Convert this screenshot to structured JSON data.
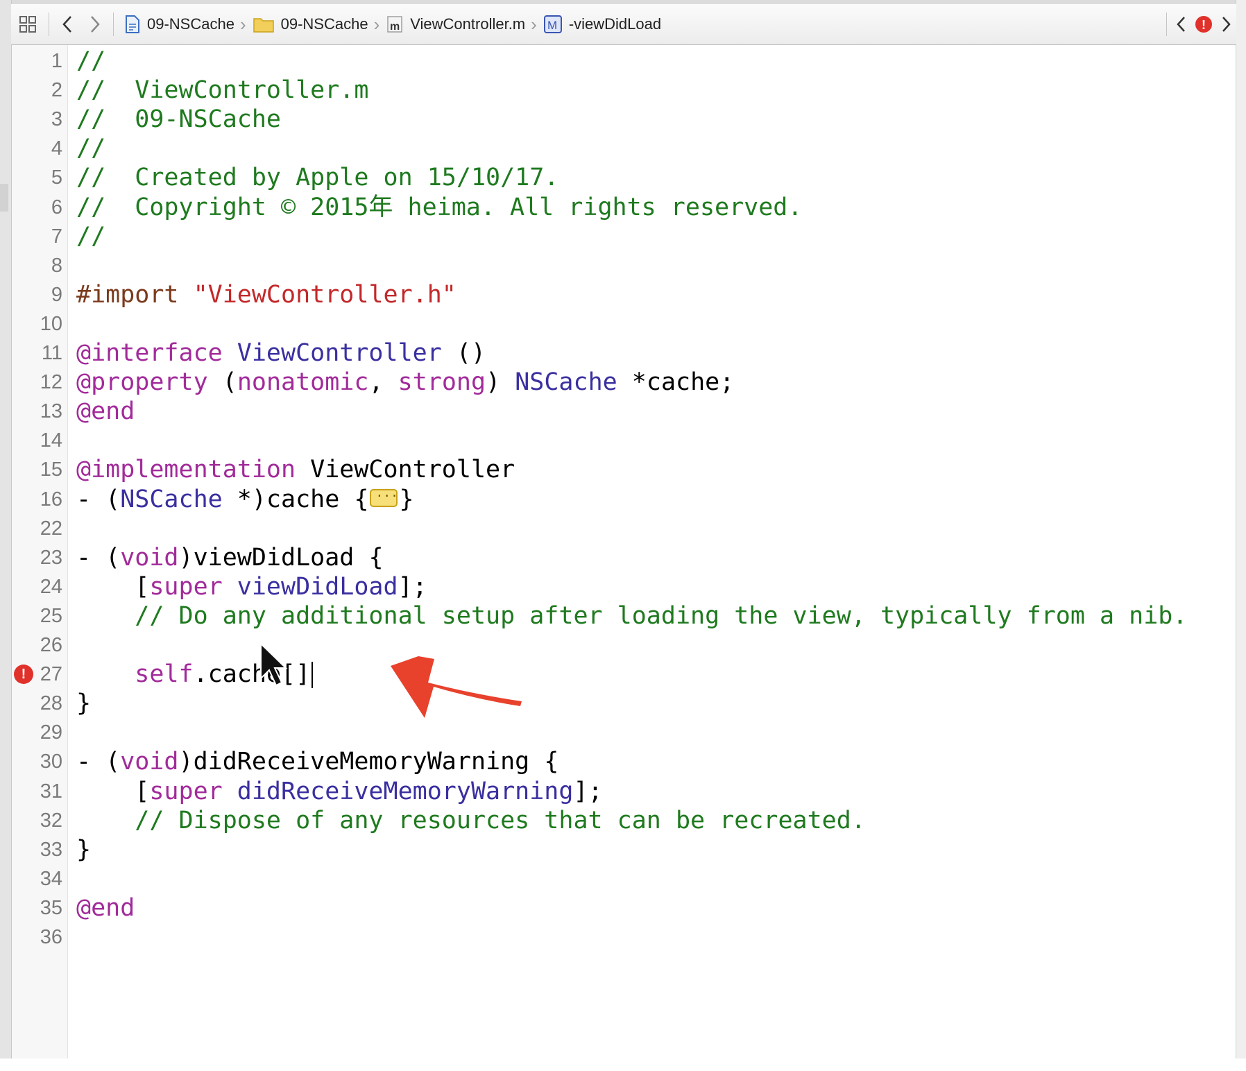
{
  "jumpbar": {
    "crumbs": [
      {
        "label": "09-NSCache",
        "icon": "project-file-icon"
      },
      {
        "label": "09-NSCache",
        "icon": "folder-icon"
      },
      {
        "label": "ViewController.m",
        "icon": "objc-m-file-icon"
      },
      {
        "label": "-viewDidLoad",
        "icon": "method-icon"
      }
    ],
    "method_icon_letter": "M",
    "m_file_letter": "m",
    "issue_badge": "!"
  },
  "editor": {
    "error_line": "27",
    "lines": [
      {
        "n": "1",
        "tokens": [
          {
            "t": "//",
            "c": "t-comment"
          }
        ]
      },
      {
        "n": "2",
        "tokens": [
          {
            "t": "//  ViewController.m",
            "c": "t-comment"
          }
        ]
      },
      {
        "n": "3",
        "tokens": [
          {
            "t": "//  09-NSCache",
            "c": "t-comment"
          }
        ]
      },
      {
        "n": "4",
        "tokens": [
          {
            "t": "//",
            "c": "t-comment"
          }
        ]
      },
      {
        "n": "5",
        "tokens": [
          {
            "t": "//  Created by Apple on 15/10/17.",
            "c": "t-comment"
          }
        ]
      },
      {
        "n": "6",
        "tokens": [
          {
            "t": "//  Copyright © 2015年 heima. All rights reserved.",
            "c": "t-comment"
          }
        ]
      },
      {
        "n": "7",
        "tokens": [
          {
            "t": "//",
            "c": "t-comment"
          }
        ]
      },
      {
        "n": "8",
        "tokens": []
      },
      {
        "n": "9",
        "tokens": [
          {
            "t": "#import ",
            "c": "t-pre"
          },
          {
            "t": "\"ViewController.h\"",
            "c": "t-string"
          }
        ]
      },
      {
        "n": "10",
        "tokens": []
      },
      {
        "n": "11",
        "tokens": [
          {
            "t": "@interface",
            "c": "t-key"
          },
          {
            "t": " ViewController ",
            "c": "t-class"
          },
          {
            "t": "()",
            "c": "t-plain"
          }
        ]
      },
      {
        "n": "12",
        "tokens": [
          {
            "t": "@property",
            "c": "t-key"
          },
          {
            "t": " (",
            "c": "t-plain"
          },
          {
            "t": "nonatomic",
            "c": "t-key"
          },
          {
            "t": ", ",
            "c": "t-plain"
          },
          {
            "t": "strong",
            "c": "t-key"
          },
          {
            "t": ") ",
            "c": "t-plain"
          },
          {
            "t": "NSCache",
            "c": "t-class"
          },
          {
            "t": " *cache;",
            "c": "t-plain"
          }
        ]
      },
      {
        "n": "13",
        "tokens": [
          {
            "t": "@end",
            "c": "t-key"
          }
        ]
      },
      {
        "n": "14",
        "tokens": []
      },
      {
        "n": "15",
        "tokens": [
          {
            "t": "@implementation",
            "c": "t-key"
          },
          {
            "t": " ViewController",
            "c": "t-plain"
          }
        ]
      },
      {
        "n": "16",
        "tokens": [
          {
            "t": "- (",
            "c": "t-plain"
          },
          {
            "t": "NSCache",
            "c": "t-class"
          },
          {
            "t": " *)cache {",
            "c": "t-plain"
          },
          {
            "fold": true
          },
          {
            "t": "}",
            "c": "t-plain"
          }
        ]
      },
      {
        "n": "22",
        "tokens": []
      },
      {
        "n": "23",
        "tokens": [
          {
            "t": "- (",
            "c": "t-plain"
          },
          {
            "t": "void",
            "c": "t-key"
          },
          {
            "t": ")viewDidLoad {",
            "c": "t-plain"
          }
        ]
      },
      {
        "n": "24",
        "tokens": [
          {
            "t": "    [",
            "c": "t-plain"
          },
          {
            "t": "super",
            "c": "t-key"
          },
          {
            "t": " viewDidLoad",
            "c": "t-method"
          },
          {
            "t": "];",
            "c": "t-plain"
          }
        ]
      },
      {
        "n": "25",
        "tokens": [
          {
            "t": "    // Do any additional setup after loading the view, typically from a nib.",
            "c": "t-comment"
          }
        ]
      },
      {
        "n": "26",
        "tokens": []
      },
      {
        "n": "27",
        "tokens": [
          {
            "t": "    ",
            "c": "t-plain"
          },
          {
            "t": "self",
            "c": "t-key"
          },
          {
            "t": ".cache[]",
            "c": "t-plain"
          },
          {
            "caret": true
          }
        ]
      },
      {
        "n": "28",
        "tokens": [
          {
            "t": "}",
            "c": "t-plain"
          }
        ]
      },
      {
        "n": "29",
        "tokens": []
      },
      {
        "n": "30",
        "tokens": [
          {
            "t": "- (",
            "c": "t-plain"
          },
          {
            "t": "void",
            "c": "t-key"
          },
          {
            "t": ")didReceiveMemoryWarning {",
            "c": "t-plain"
          }
        ]
      },
      {
        "n": "31",
        "tokens": [
          {
            "t": "    [",
            "c": "t-plain"
          },
          {
            "t": "super",
            "c": "t-key"
          },
          {
            "t": " didReceiveMemoryWarning",
            "c": "t-method"
          },
          {
            "t": "];",
            "c": "t-plain"
          }
        ]
      },
      {
        "n": "32",
        "tokens": [
          {
            "t": "    // Dispose of any resources that can be recreated.",
            "c": "t-comment"
          }
        ]
      },
      {
        "n": "33",
        "tokens": [
          {
            "t": "}",
            "c": "t-plain"
          }
        ]
      },
      {
        "n": "34",
        "tokens": []
      },
      {
        "n": "35",
        "tokens": [
          {
            "t": "@end",
            "c": "t-key"
          }
        ]
      },
      {
        "n": "36",
        "tokens": []
      }
    ]
  },
  "colors": {
    "comment": "#1f7a1f",
    "keyword": "#a22b9a",
    "string": "#c3282a",
    "class": "#3a2fa0",
    "error": "#e0312b",
    "annotation_arrow": "#e8412c"
  }
}
